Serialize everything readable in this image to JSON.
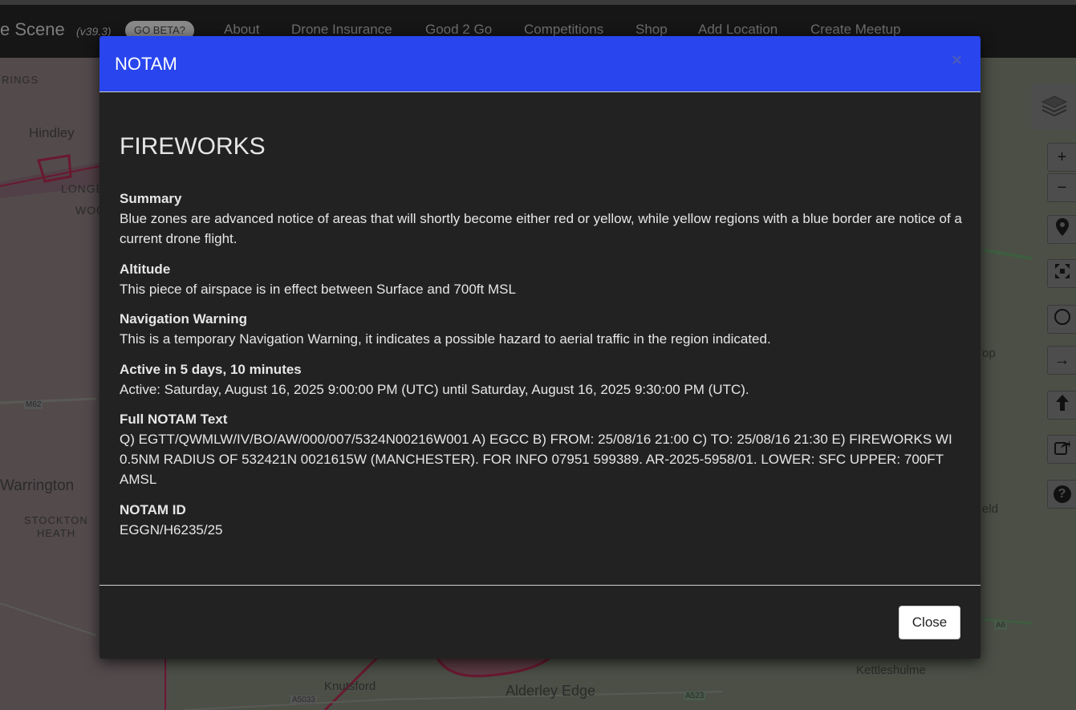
{
  "navbar": {
    "brand": "e Scene",
    "version": "(v39.3)",
    "beta_label": "GO BETA?",
    "links": [
      "About",
      "Drone Insurance",
      "Good 2 Go",
      "Competitions",
      "Shop",
      "Add Location",
      "Create Meetup"
    ]
  },
  "map": {
    "labels": [
      "RINGS",
      "Hindley",
      "M62",
      "LONGE",
      "WOO",
      "Warrington",
      "STOCKTON",
      "HEATH",
      "Knutsford",
      "Alderley Edge",
      "Kettleshulme",
      "A5033",
      "A523",
      "A6",
      "op",
      "eld"
    ]
  },
  "controls": {
    "zoom_in": "+",
    "zoom_out": "−",
    "arrow": "→",
    "help": "?"
  },
  "modal": {
    "title": "NOTAM",
    "close_x": "×",
    "headline": "FIREWORKS",
    "sections": [
      {
        "heading": "Summary",
        "text": "Blue zones are advanced notice of areas that will shortly become either red or yellow, while yellow regions with a blue border are notice of a current drone flight."
      },
      {
        "heading": "Altitude",
        "text": "This piece of airspace is in effect between Surface and 700ft MSL"
      },
      {
        "heading": "Navigation Warning",
        "text": "This is a temporary Navigation Warning, it indicates a possible hazard to aerial traffic in the region indicated."
      },
      {
        "heading": "Active in 5 days, 10 minutes",
        "text": "Active: Saturday, August 16, 2025 9:00:00 PM (UTC) until Saturday, August 16, 2025 9:30:00 PM (UTC)."
      },
      {
        "heading": "Full NOTAM Text",
        "text": "Q) EGTT/QWMLW/IV/BO/AW/000/007/5324N00216W001 A) EGCC B) FROM: 25/08/16 21:00 C) TO: 25/08/16 21:30 E) FIREWORKS WI 0.5NM RADIUS OF 532421N 0021615W (MANCHESTER). FOR INFO 07951 599389. AR-2025-5958/01. LOWER: SFC UPPER: 700FT AMSL"
      },
      {
        "heading": "NOTAM ID",
        "text": "EGGN/H6235/25"
      }
    ],
    "close_button": "Close"
  }
}
